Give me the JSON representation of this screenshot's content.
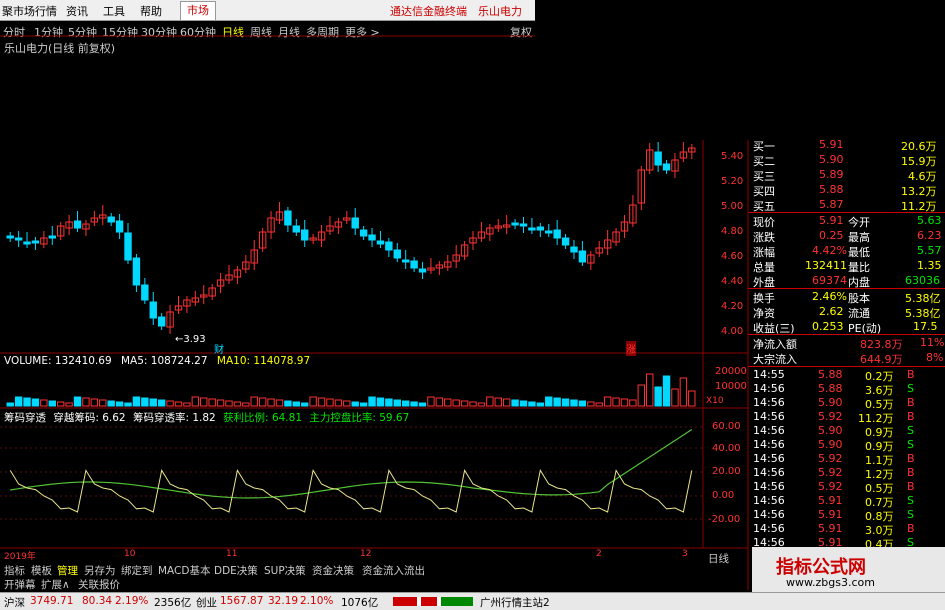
{
  "menu": {
    "items": [
      "聚市场行情",
      "资讯",
      "工具",
      "帮助"
    ],
    "active": "市场",
    "broker": "通达信金融终端",
    "stock": "乐山电力"
  },
  "periods": {
    "items": [
      "分时",
      "1分钟",
      "5分钟",
      "15分钟",
      "30分钟",
      "60分钟",
      "日线",
      "周线",
      "月线",
      "多周期",
      "更多 >"
    ],
    "selected": "日线",
    "right": "复权"
  },
  "chart_title": "乐山电力(日线 前复权)",
  "price_axis": [
    "5.40",
    "5.20",
    "5.00",
    "4.80",
    "4.60",
    "4.40",
    "4.20",
    "4.00"
  ],
  "low_annotation": "3.93",
  "marker_cai": "财",
  "marker_zhang": "涨",
  "volume_header": {
    "label": "VOLUME: 132410.69",
    "ma5": "MA5: 108724.27",
    "ma10": "MA10: 114078.97"
  },
  "volume_axis": [
    "20000",
    "10000",
    "X10"
  ],
  "ind_header": {
    "name": "筹码穿透",
    "a": "穿越筹码: 6.62",
    "b": "筹码穿透率: 1.82",
    "c": "获利比例: 64.81",
    "d": "主力控盘比率: 59.67"
  },
  "ind_axis": [
    "60.00",
    "40.00",
    "20.00",
    "0.00",
    "-20.00"
  ],
  "x_axis": [
    "2019年",
    "10",
    "11",
    "12",
    "2",
    "3"
  ],
  "right_panel": {
    "buy": [
      {
        "label": "买一",
        "price": "5.91",
        "vol": "20.6万"
      },
      {
        "label": "买二",
        "price": "5.90",
        "vol": "15.9万"
      },
      {
        "label": "买三",
        "price": "5.89",
        "vol": "4.6万"
      },
      {
        "label": "买四",
        "price": "5.88",
        "vol": "13.2万"
      },
      {
        "label": "买五",
        "price": "5.87",
        "vol": "11.2万"
      }
    ],
    "quote": [
      {
        "l1": "现价",
        "v1": "5.91",
        "l2": "今开",
        "v2": "5.63"
      },
      {
        "l1": "涨跌",
        "v1": "0.25",
        "l2": "最高",
        "v2": "6.23"
      },
      {
        "l1": "涨幅",
        "v1": "4.42%",
        "l2": "最低",
        "v2": "5.57"
      },
      {
        "l1": "总量",
        "v1": "132411",
        "l2": "量比",
        "v2": "1.35"
      },
      {
        "l1": "外盘",
        "v1": "69374",
        "l2": "内盘",
        "v2": "63036"
      }
    ],
    "fund": [
      {
        "l1": "换手",
        "v1": "2.46%",
        "l2": "股本",
        "v2": "5.38亿"
      },
      {
        "l1": "净资",
        "v1": "2.62",
        "l2": "流通",
        "v2": "5.38亿"
      },
      {
        "l1": "收益(三)",
        "v1": "0.253",
        "l2": "PE(动)",
        "v2": "17.5"
      }
    ],
    "flow": [
      {
        "label": "净流入额",
        "value": "823.8万",
        "pct": "11%"
      },
      {
        "label": "大宗流入",
        "value": "644.9万",
        "pct": "8%"
      }
    ],
    "ticks": [
      {
        "t": "14:55",
        "p": "5.88",
        "v": "0.2万",
        "s": "B"
      },
      {
        "t": "14:56",
        "p": "5.88",
        "v": "3.6万",
        "s": "S"
      },
      {
        "t": "14:56",
        "p": "5.90",
        "v": "0.5万",
        "s": "B"
      },
      {
        "t": "14:56",
        "p": "5.92",
        "v": "11.2万",
        "s": "B"
      },
      {
        "t": "14:56",
        "p": "5.90",
        "v": "0.9万",
        "s": "S"
      },
      {
        "t": "14:56",
        "p": "5.90",
        "v": "0.9万",
        "s": "S"
      },
      {
        "t": "14:56",
        "p": "5.92",
        "v": "1.1万",
        "s": "B"
      },
      {
        "t": "14:56",
        "p": "5.92",
        "v": "1.2万",
        "s": "B"
      },
      {
        "t": "14:56",
        "p": "5.92",
        "v": "0.5万",
        "s": "B"
      },
      {
        "t": "14:56",
        "p": "5.91",
        "v": "0.7万",
        "s": "S"
      },
      {
        "t": "14:56",
        "p": "5.91",
        "v": "0.8万",
        "s": "S"
      },
      {
        "t": "14:56",
        "p": "5.91",
        "v": "3.0万",
        "s": "B"
      },
      {
        "t": "14:56",
        "p": "5.91",
        "v": "0.4万",
        "s": "S"
      }
    ]
  },
  "bottom_tabs": [
    "指标",
    "模板",
    "管理",
    "另存为",
    "绑定到",
    "MACD基本",
    "DDE决策",
    "SUP决策",
    "资金决策",
    "资金流入流出"
  ],
  "bottom_tabs_selected": "管理",
  "bottom_right_tab": "日线",
  "bottom_tabs2": [
    "开弹幕",
    "扩展∧",
    "关联报价"
  ],
  "status": {
    "sh_label": "沪深",
    "sh_val": "3749.71",
    "sh_chg": "80.34",
    "sh_pct": "2.19%",
    "sh_amt": "2356亿",
    "cy_label": "创业",
    "cy_val": "1567.87",
    "cy_chg": "32.19",
    "cy_pct": "2.10%",
    "cy_amt": "1076亿",
    "server": "广州行情主站2"
  },
  "watermark": {
    "title": "指标公式网",
    "url": "www.zbgs3.com"
  },
  "colors": {
    "up": "#ff3232",
    "down": "#00d8ff",
    "ma": "#ffffff",
    "ind_yellow": "#e8e48a",
    "ind_green": "#52c234"
  }
}
